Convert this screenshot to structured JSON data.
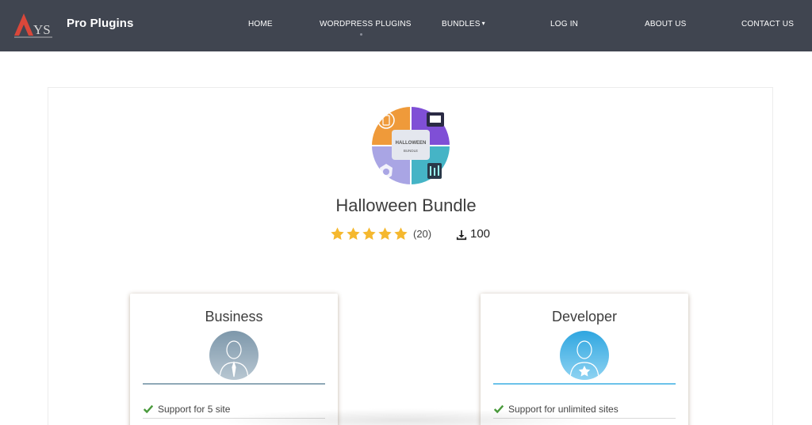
{
  "header": {
    "brand": "Pro Plugins",
    "nav": [
      {
        "label": "HOME"
      },
      {
        "label": "WORDPRESS PLUGINS"
      },
      {
        "label": "BUNDLES"
      },
      {
        "label": "LOG IN"
      },
      {
        "label": "ABOUT US"
      },
      {
        "label": "CONTACT US"
      }
    ],
    "bundles_caret": "▾"
  },
  "product": {
    "logo_text_main": "HALLOWEEN",
    "logo_text_sub": "BUNDLE",
    "title": "Halloween Bundle",
    "rating_stars": 5,
    "rating_count": "(20)",
    "downloads": "100"
  },
  "plans": [
    {
      "name": "Business",
      "feature": "Support for 5 site",
      "accent": "#8fa8b7"
    },
    {
      "name": "Developer",
      "feature": "Support for unlimited sites",
      "accent": "#6bc2ea"
    }
  ],
  "colors": {
    "header_bg": "#404550",
    "star": "#f5b82e",
    "check": "#4a9a3c"
  }
}
